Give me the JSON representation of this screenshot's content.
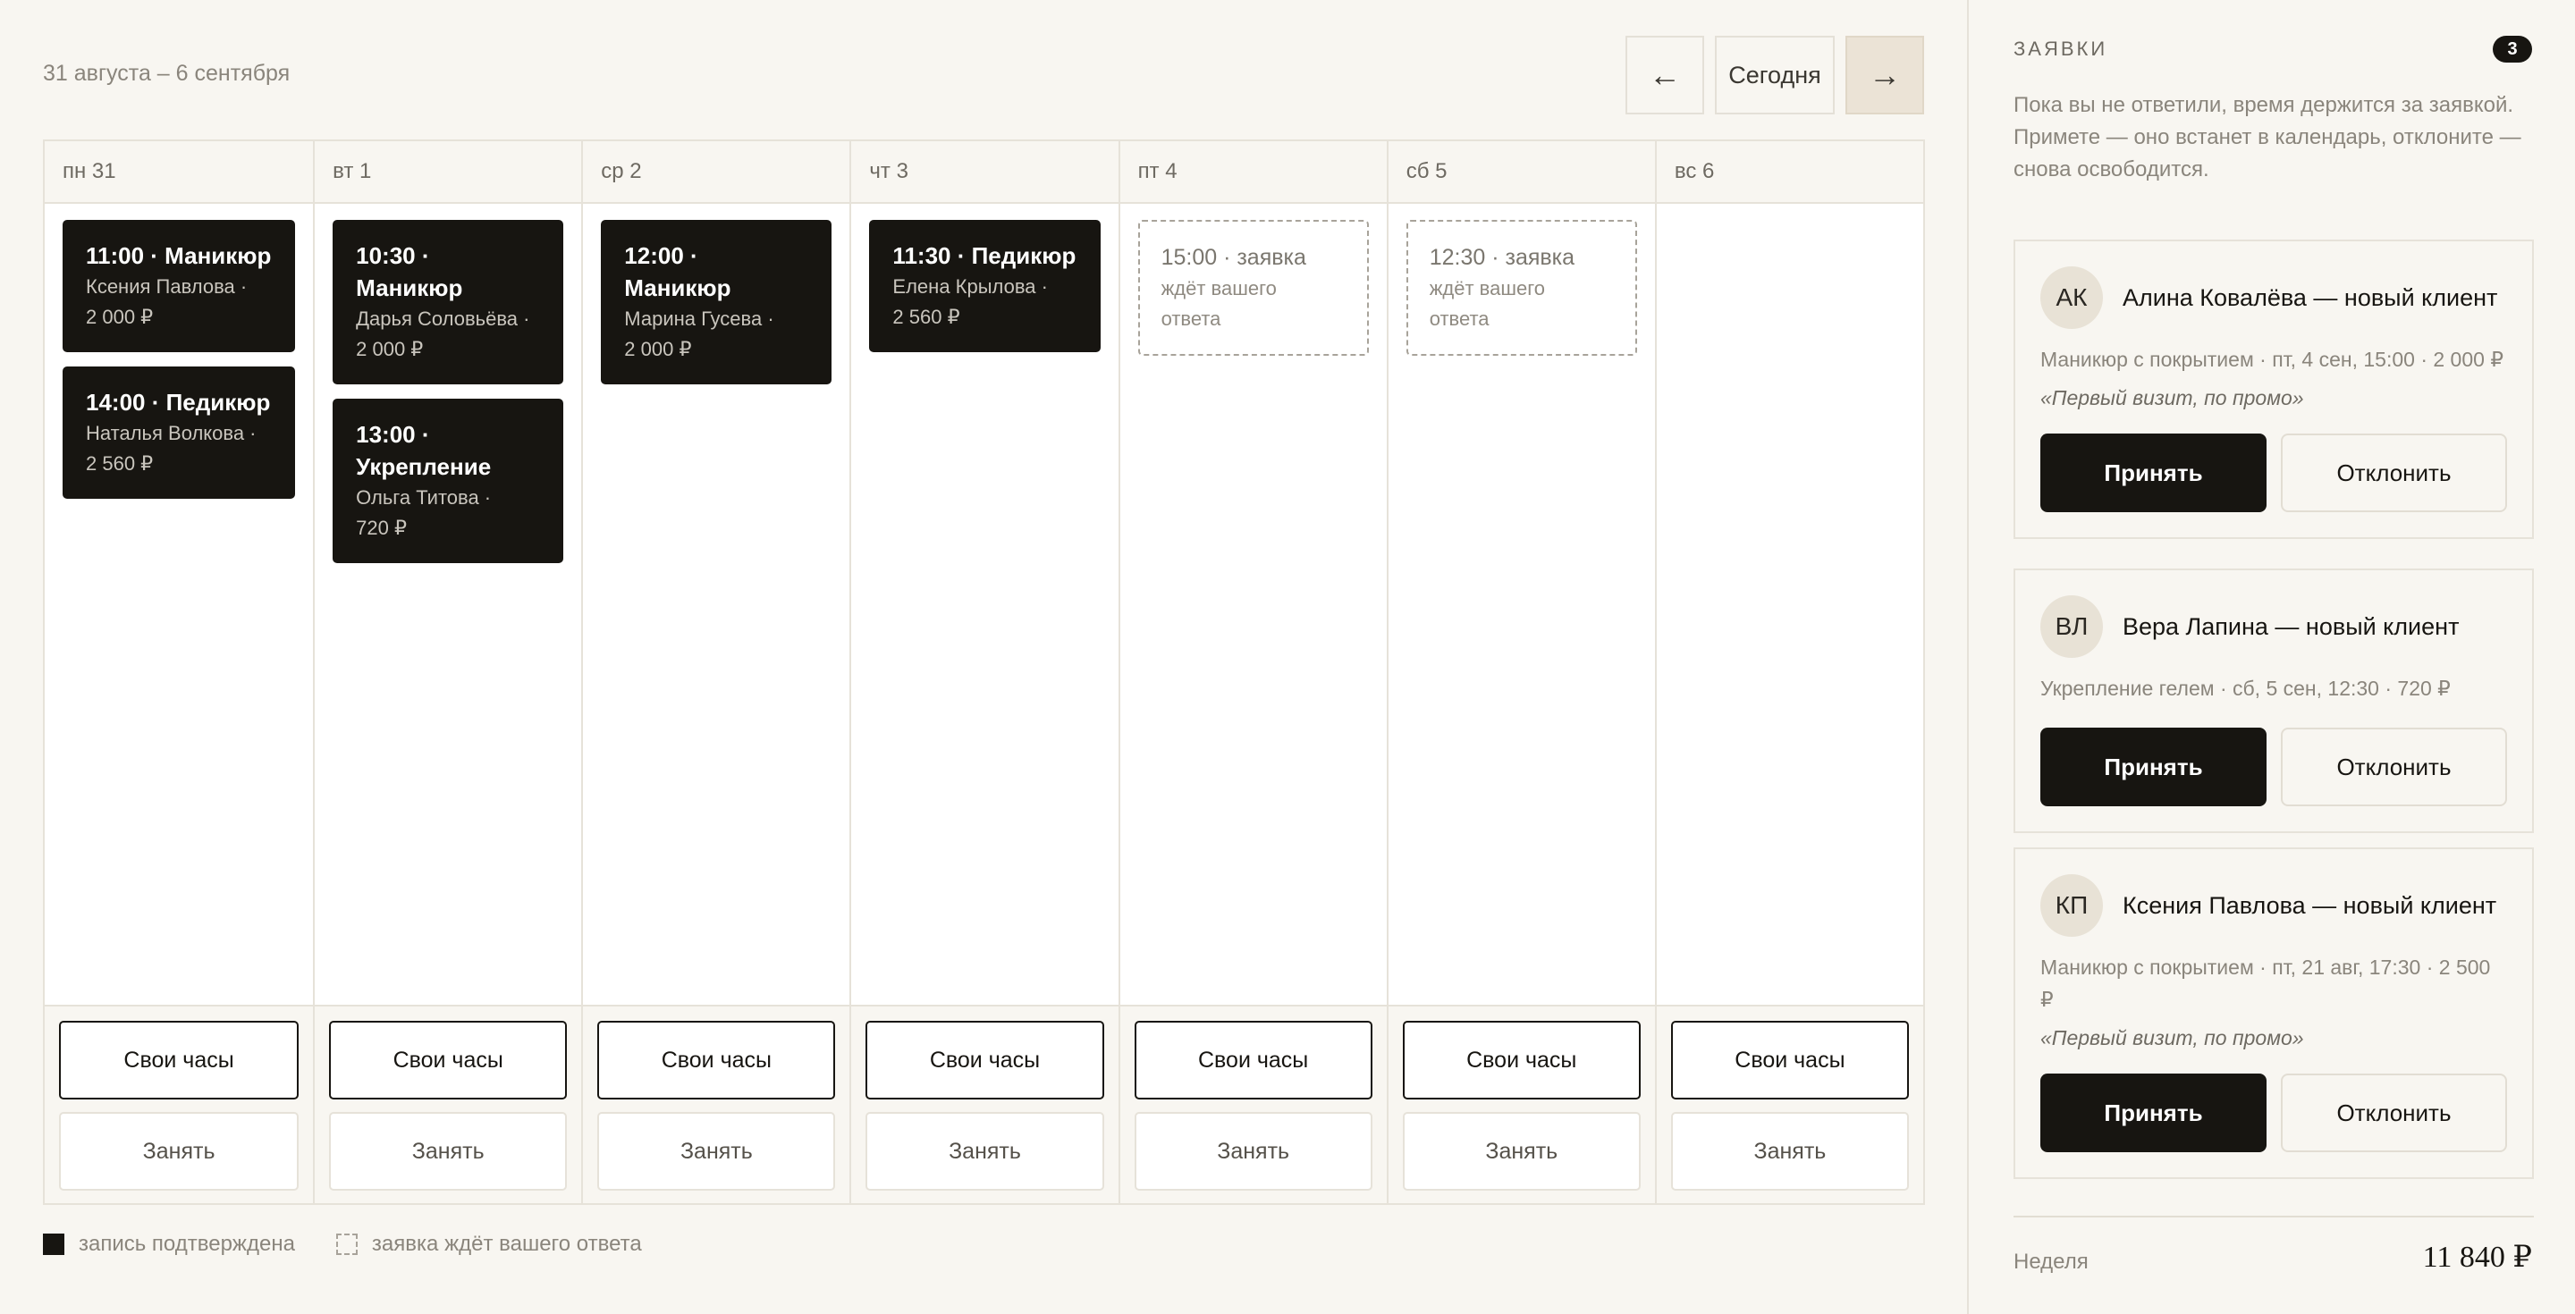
{
  "header": {
    "week_range": "31 августа – 6 сентября",
    "prev_label": "←",
    "today_label": "Сегодня",
    "next_label": "→"
  },
  "days": [
    {
      "label": "пн 31",
      "items": [
        {
          "kind": "confirmed",
          "title": "11:00 · Маникюр",
          "client": "Ксения Павлова ·",
          "price": "2 000 ₽"
        },
        {
          "kind": "confirmed",
          "title": "14:00 · Педикюр",
          "client": "Наталья Волкова ·",
          "price": "2 560 ₽"
        }
      ]
    },
    {
      "label": "вт 1",
      "items": [
        {
          "kind": "confirmed",
          "title": "10:30 · Маникюр",
          "client": "Дарья Соловьёва ·",
          "price": "2 000 ₽"
        },
        {
          "kind": "confirmed",
          "title": "13:00 · Укрепление",
          "client": "Ольга Титова ·",
          "price": "720 ₽"
        }
      ]
    },
    {
      "label": "ср 2",
      "items": [
        {
          "kind": "confirmed",
          "title": "12:00 · Маникюр",
          "client": "Марина Гусева ·",
          "price": "2 000 ₽"
        }
      ]
    },
    {
      "label": "чт 3",
      "items": [
        {
          "kind": "confirmed",
          "title": "11:30 · Педикюр",
          "client": "Елена Крылова ·",
          "price": "2 560 ₽"
        }
      ]
    },
    {
      "label": "пт 4",
      "items": [
        {
          "kind": "pending",
          "title": "15:00 · заявка",
          "client": "ждёт вашего",
          "price": "ответа"
        }
      ]
    },
    {
      "label": "сб 5",
      "items": [
        {
          "kind": "pending",
          "title": "12:30 · заявка",
          "client": "ждёт вашего",
          "price": "ответа"
        }
      ]
    },
    {
      "label": "вс 6",
      "items": []
    }
  ],
  "day_actions": {
    "own_hours_label": "Свои часы",
    "take_label": "Занять"
  },
  "legend": {
    "confirmed": "запись подтверждена",
    "pending": "заявка ждёт вашего ответа"
  },
  "sidebar": {
    "title": "ЗАЯВКИ",
    "count": "3",
    "hint": "Пока вы не ответили, время держится за заявкой. Примете — оно встанет в календарь, отклоните — снова освободится.",
    "accept_label": "Принять",
    "decline_label": "Отклонить",
    "requests": [
      {
        "initials": "АК",
        "name": "Алина Ковалёва — новый клиент",
        "details": "Маникюр с покрытием · пт, 4 сен, 15:00 · 2 000 ₽",
        "note": "«Первый визит, по промо»"
      },
      {
        "initials": "ВЛ",
        "name": "Вера Лапина — новый клиент",
        "details": "Укрепление гелем · сб, 5 сен, 12:30 · 720 ₽",
        "note": ""
      },
      {
        "initials": "КП",
        "name": "Ксения Павлова — новый клиент",
        "details": "Маникюр с покрытием · пт, 21 авг, 17:30 · 2 500 ₽",
        "note": "«Первый визит, по промо»"
      }
    ],
    "week_label": "Неделя",
    "week_total": "11 840 ₽"
  }
}
